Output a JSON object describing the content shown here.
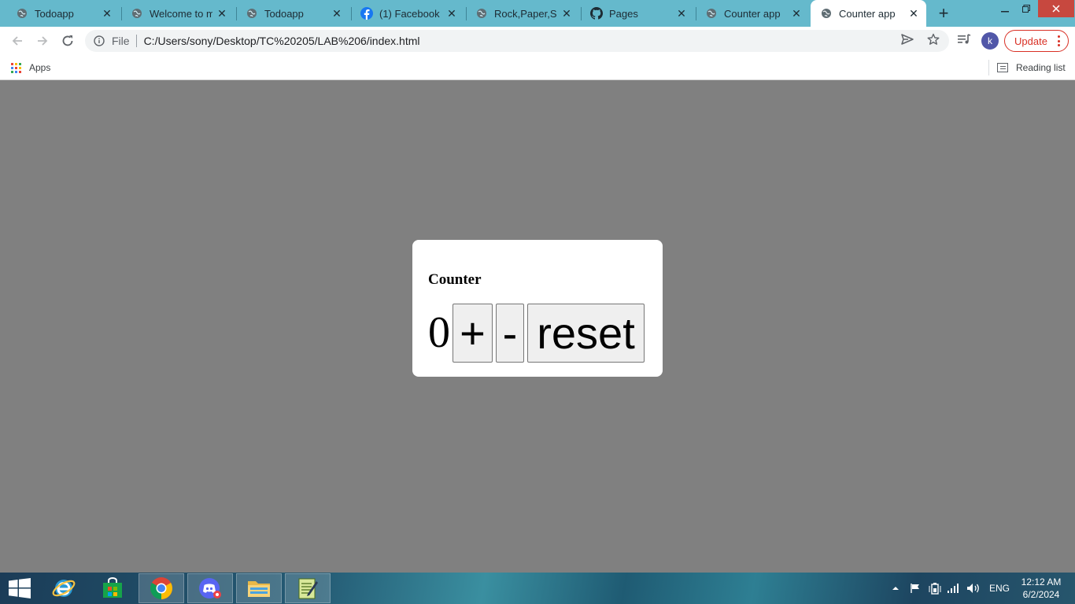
{
  "browser": {
    "tabs": [
      {
        "title": "Todoapp",
        "icon": "globe-icon",
        "active": false
      },
      {
        "title": "Welcome to my",
        "icon": "globe-icon",
        "active": false
      },
      {
        "title": "Todoapp",
        "icon": "globe-icon",
        "active": false
      },
      {
        "title": "(1) Facebook",
        "icon": "facebook-icon",
        "active": false
      },
      {
        "title": "Rock,Paper,Scis",
        "icon": "globe-icon",
        "active": false
      },
      {
        "title": "Pages",
        "icon": "github-icon",
        "active": false
      },
      {
        "title": "Counter app",
        "icon": "globe-icon",
        "active": false
      },
      {
        "title": "Counter app",
        "icon": "globe-icon",
        "active": true
      }
    ],
    "address": {
      "scheme_label": "File",
      "url": "C:/Users/sony/Desktop/TC%20205/LAB%206/index.html"
    },
    "profile_initial": "k",
    "update_label": "Update",
    "bookmarks": {
      "apps_label": "Apps",
      "reading_list_label": "Reading list"
    }
  },
  "page": {
    "heading": "Counter",
    "count": "0",
    "buttons": {
      "increment": "+",
      "decrement": "-",
      "reset": "reset"
    }
  },
  "taskbar": {
    "language": "ENG",
    "time": "12:12 AM",
    "date": "6/2/2024",
    "pinned": [
      "start-icon",
      "internet-explorer-icon",
      "store-icon",
      "chrome-icon",
      "discord-icon",
      "file-explorer-icon",
      "notepad-icon"
    ]
  },
  "colors": {
    "tabstrip": "#65b9cc",
    "page_background": "#808080",
    "update_accent": "#d93025",
    "profile": "#5157a8"
  }
}
